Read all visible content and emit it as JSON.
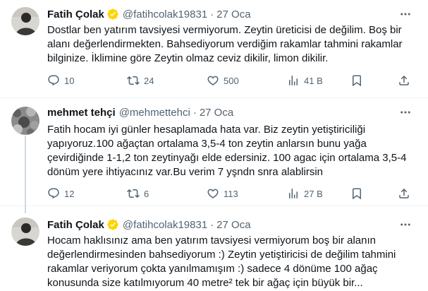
{
  "tweets": [
    {
      "name": "Fatih Çolak",
      "handle": "@fatihcolak19831",
      "sep": "·",
      "date": "27 Oca",
      "text": "Dostlar ben yatırım tavsiyesi vermiyorum. Zeytin üreticisi de değilim. Boş bir alanı değerlendirmekten. Bahsediyorum verdiğim rakamlar tahmini rakamlar bilginize. İklimine göre Zeytin olmaz ceviz dikilir, limon dikilir.",
      "replies": "10",
      "retweets": "24",
      "likes": "500",
      "views": "41 B"
    },
    {
      "name": "mehmet tehçi",
      "handle": "@mehmettehci",
      "sep": "·",
      "date": "27 Oca",
      "text": "Fatih hocam iyi günler hesaplamada hata var. Biz zeytin yetiştiriciliği yapıyoruz.100 ağaçtan ortalama 3,5-4 ton zeytin anlarsın bunu yağa çevirdiğinde 1-1,2 ton  zeytinyağı elde edersiniz. 100 agac için ortalama 3,5-4 dönüm yere ihtiyacınız var.Bu verim  7 yşndn snra alablirsin",
      "replies": "12",
      "retweets": "6",
      "likes": "113",
      "views": "27 B"
    },
    {
      "name": "Fatih Çolak",
      "handle": "@fatihcolak19831",
      "sep": "·",
      "date": "27 Oca",
      "text": "Hocam haklısınız ama ben yatırım tavsiyesi vermiyorum boş bir alanın değerlendirmesinden bahsediyorum :) Zeytin yetiştiricisi de değilim tahmini rakamlar veriyorum çokta yanılmamışım :) sadece 4 dönüme 100 ağaç konusunda size katılmıyorum 40 metre² tek bir ağaç için büyük bir..."
    }
  ],
  "icons": {
    "more": "more-icon",
    "verified": "verified-badge-icon",
    "reply": "reply-icon",
    "retweet": "retweet-icon",
    "like": "heart-icon",
    "views": "views-icon",
    "bookmark": "bookmark-icon",
    "share": "share-icon"
  },
  "colors": {
    "verified": "#ffd400",
    "secondary_text": "#536471",
    "thread_line": "#cfd9de"
  }
}
